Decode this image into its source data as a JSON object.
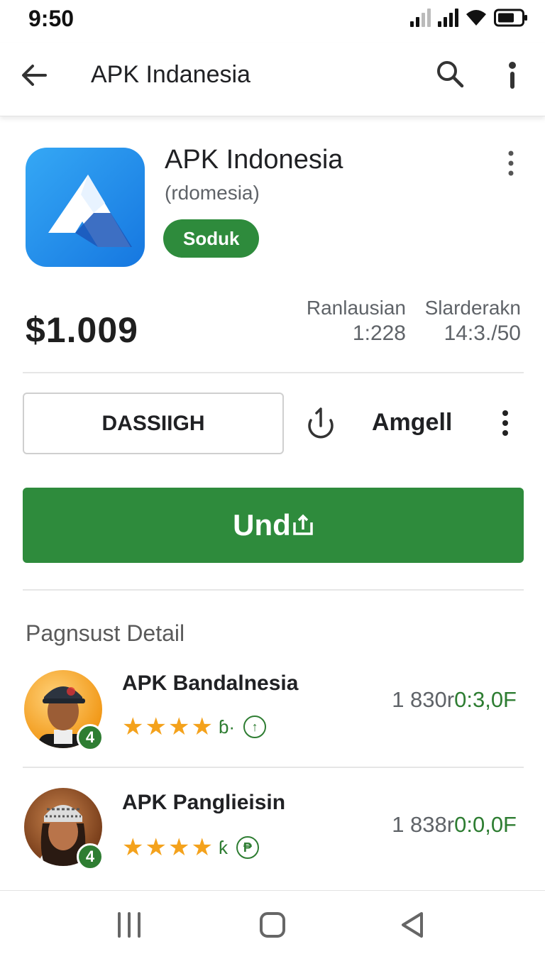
{
  "status_bar": {
    "time": "9:50"
  },
  "app_bar": {
    "title": "APK Indanesia"
  },
  "app": {
    "name": "APK Indonesia",
    "subtitle": "(rdomesia)",
    "badge": "Soduk",
    "price": "$1.009",
    "stats": [
      {
        "label": "Ranlausian",
        "value": "1:228"
      },
      {
        "label": "Slarderakn",
        "value": "14:3./50"
      }
    ]
  },
  "actions": {
    "outline_button": "DASSIIGH",
    "secondary_label": "Amgell",
    "primary_button": "Und"
  },
  "section": {
    "title": "Pagnsust Detail"
  },
  "list": [
    {
      "name": "APK Bandalnesia",
      "badge": "4",
      "suffix": "ɓ·",
      "count_prefix": "1 830r",
      "count_value": "0:3,0F",
      "icon_glyph": "↑"
    },
    {
      "name": "APK Panglieisin",
      "badge": "4",
      "suffix": "ƙ",
      "count_prefix": "1 838r",
      "count_value": "0:0,0F",
      "icon_glyph": "₱"
    }
  ],
  "colors": {
    "accent": "#2e8b3c",
    "icon_blue": "#1677e0",
    "star": "#f4a21c"
  }
}
